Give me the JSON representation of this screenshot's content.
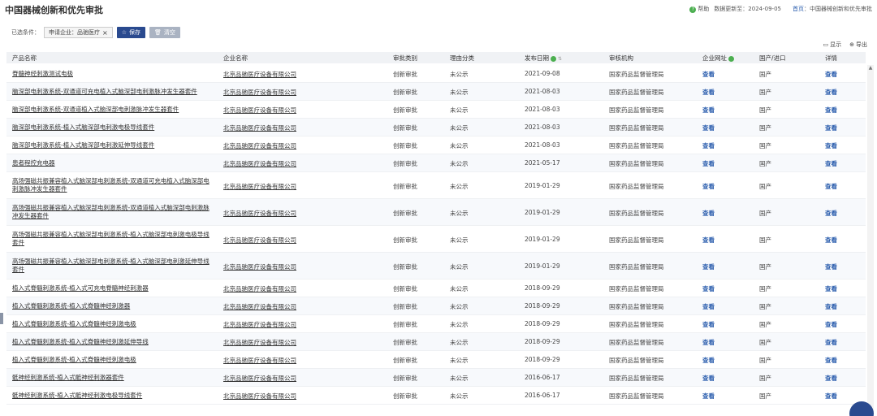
{
  "page": {
    "title": "中国器械创新和优先审批",
    "help_label": "帮助",
    "update_text": "数据更新至：2024-09-05",
    "breadcrumb_home": "首页",
    "breadcrumb_sep": "：",
    "breadcrumb_current": "中国器械创新和优先审批"
  },
  "filter": {
    "label": "已选条件：",
    "tag": "申请企业：品驰医疗",
    "tag_close": "×",
    "save_label": "保存",
    "clear_label": "清空"
  },
  "tools": {
    "display_label": "显示",
    "export_label": "导出"
  },
  "table": {
    "headers": {
      "product": "产品名称",
      "company": "企业名称",
      "type": "审批类别",
      "reason": "理由分类",
      "date": "发布日期",
      "agency": "审核机构",
      "website": "企业网址",
      "origin": "国产/进口",
      "detail": "详情"
    },
    "rows": [
      {
        "product": "脊髓神经刺激测试电极",
        "company": "北京品驰医疗设备有限公司",
        "type": "创新审批",
        "reason": "未公示",
        "date": "2021-09-08",
        "agency": "国家药品监督管理局",
        "website": "查看",
        "origin": "国产",
        "detail": "查看"
      },
      {
        "product": "脑深部电刺激系统-双通道可充电植入式脑深部电刺激脉冲发生器套件",
        "company": "北京品驰医疗设备有限公司",
        "type": "创新审批",
        "reason": "未公示",
        "date": "2021-08-03",
        "agency": "国家药品监督管理局",
        "website": "查看",
        "origin": "国产",
        "detail": "查看"
      },
      {
        "product": "脑深部电刺激系统-双通道植入式脑深部电刺激脉冲发生器套件",
        "company": "北京品驰医疗设备有限公司",
        "type": "创新审批",
        "reason": "未公示",
        "date": "2021-08-03",
        "agency": "国家药品监督管理局",
        "website": "查看",
        "origin": "国产",
        "detail": "查看"
      },
      {
        "product": "脑深部电刺激系统-植入式脑深部电刺激电极导线套件",
        "company": "北京品驰医疗设备有限公司",
        "type": "创新审批",
        "reason": "未公示",
        "date": "2021-08-03",
        "agency": "国家药品监督管理局",
        "website": "查看",
        "origin": "国产",
        "detail": "查看"
      },
      {
        "product": "脑深部电刺激系统-植入式脑深部电刺激延伸导线套件",
        "company": "北京品驰医疗设备有限公司",
        "type": "创新审批",
        "reason": "未公示",
        "date": "2021-08-03",
        "agency": "国家药品监督管理局",
        "website": "查看",
        "origin": "国产",
        "detail": "查看"
      },
      {
        "product": "患者程控充电器",
        "company": "北京品驰医疗设备有限公司",
        "type": "创新审批",
        "reason": "未公示",
        "date": "2021-05-17",
        "agency": "国家药品监督管理局",
        "website": "查看",
        "origin": "国产",
        "detail": "查看"
      },
      {
        "product": "高场强磁共振兼容植入式脑深部电刺激系统-双通道可充电植入式脑深部电刺激脉冲发生器套件",
        "company": "北京品驰医疗设备有限公司",
        "type": "创新审批",
        "reason": "未公示",
        "date": "2019-01-29",
        "agency": "国家药品监督管理局",
        "website": "查看",
        "origin": "国产",
        "detail": "查看"
      },
      {
        "product": "高场强磁共振兼容植入式脑深部电刺激系统-双通道植入式脑深部电刺激脉冲发生器套件",
        "company": "北京品驰医疗设备有限公司",
        "type": "创新审批",
        "reason": "未公示",
        "date": "2019-01-29",
        "agency": "国家药品监督管理局",
        "website": "查看",
        "origin": "国产",
        "detail": "查看"
      },
      {
        "product": "高场强磁共振兼容植入式脑深部电刺激系统-植入式脑深部电刺激电极导线套件",
        "company": "北京品驰医疗设备有限公司",
        "type": "创新审批",
        "reason": "未公示",
        "date": "2019-01-29",
        "agency": "国家药品监督管理局",
        "website": "查看",
        "origin": "国产",
        "detail": "查看"
      },
      {
        "product": "高场强磁共振兼容植入式脑深部电刺激系统-植入式脑深部电刺激延伸导线套件",
        "company": "北京品驰医疗设备有限公司",
        "type": "创新审批",
        "reason": "未公示",
        "date": "2019-01-29",
        "agency": "国家药品监督管理局",
        "website": "查看",
        "origin": "国产",
        "detail": "查看"
      },
      {
        "product": "植入式脊髓刺激系统-植入式可充电脊髓神经刺激器",
        "company": "北京品驰医疗设备有限公司",
        "type": "创新审批",
        "reason": "未公示",
        "date": "2018-09-29",
        "agency": "国家药品监督管理局",
        "website": "查看",
        "origin": "国产",
        "detail": "查看"
      },
      {
        "product": "植入式脊髓刺激系统-植入式脊髓神经刺激器",
        "company": "北京品驰医疗设备有限公司",
        "type": "创新审批",
        "reason": "未公示",
        "date": "2018-09-29",
        "agency": "国家药品监督管理局",
        "website": "查看",
        "origin": "国产",
        "detail": "查看"
      },
      {
        "product": "植入式脊髓刺激系统-植入式脊髓神经刺激电极",
        "company": "北京品驰医疗设备有限公司",
        "type": "创新审批",
        "reason": "未公示",
        "date": "2018-09-29",
        "agency": "国家药品监督管理局",
        "website": "查看",
        "origin": "国产",
        "detail": "查看"
      },
      {
        "product": "植入式脊髓刺激系统-植入式脊髓神经刺激延伸导线",
        "company": "北京品驰医疗设备有限公司",
        "type": "创新审批",
        "reason": "未公示",
        "date": "2018-09-29",
        "agency": "国家药品监督管理局",
        "website": "查看",
        "origin": "国产",
        "detail": "查看"
      },
      {
        "product": "植入式脊髓刺激系统-植入式脊髓神经刺激电极",
        "company": "北京品驰医疗设备有限公司",
        "type": "创新审批",
        "reason": "未公示",
        "date": "2018-09-29",
        "agency": "国家药品监督管理局",
        "website": "查看",
        "origin": "国产",
        "detail": "查看"
      },
      {
        "product": "骶神经刺激系统-植入式骶神经刺激器套件",
        "company": "北京品驰医疗设备有限公司",
        "type": "创新审批",
        "reason": "未公示",
        "date": "2016-06-17",
        "agency": "国家药品监督管理局",
        "website": "查看",
        "origin": "国产",
        "detail": "查看"
      },
      {
        "product": "骶神经刺激系统-植入式骶神经刺激电极导线套件",
        "company": "北京品驰医疗设备有限公司",
        "type": "创新审批",
        "reason": "未公示",
        "date": "2016-06-17",
        "agency": "国家药品监督管理局",
        "website": "查看",
        "origin": "国产",
        "detail": "查看"
      }
    ]
  },
  "colors": {
    "accent": "#2a4a8f",
    "link": "#2a5dad",
    "help_green": "#4caf50"
  }
}
